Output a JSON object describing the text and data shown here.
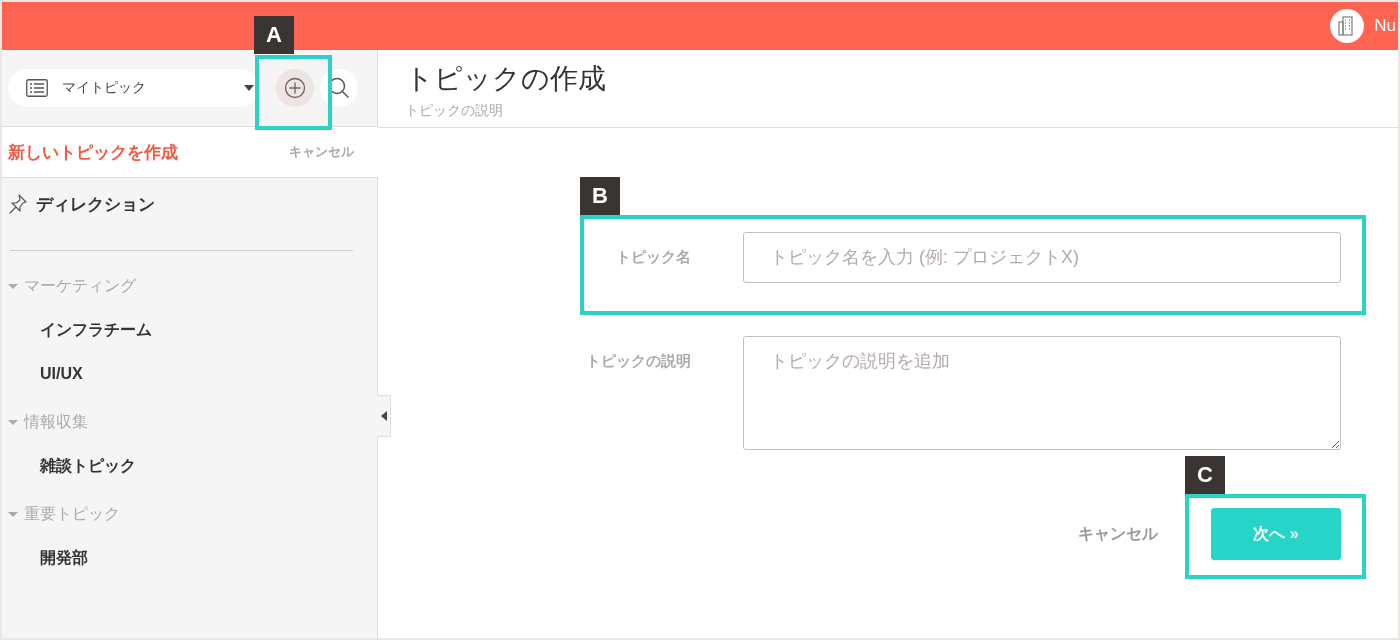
{
  "topbar": {
    "user_name": "Nu"
  },
  "sidebar": {
    "topic_select": {
      "value": "マイトピック"
    },
    "new_topic": {
      "title": "新しいトピックを作成",
      "cancel": "キャンセル"
    },
    "pinned": [
      {
        "label": "ディレクション"
      }
    ],
    "groups": [
      {
        "label": "マーケティング",
        "expanded": true,
        "children": [
          {
            "label": "インフラチーム"
          },
          {
            "label": "UI/UX"
          }
        ]
      },
      {
        "label": "情報収集",
        "expanded": true,
        "children": [
          {
            "label": "雑談トピック"
          }
        ]
      },
      {
        "label": "重要トピック",
        "expanded": true,
        "children": [
          {
            "label": "開発部"
          }
        ]
      }
    ]
  },
  "header": {
    "title": "トピックの作成",
    "subtitle": "トピックの説明"
  },
  "form": {
    "fields": [
      {
        "kind": "input",
        "label": "トピック名",
        "placeholder": "トピック名を入力 (例: プロジェクトX)"
      },
      {
        "kind": "textarea",
        "label": "トピックの説明",
        "placeholder": "トピックの説明を追加"
      }
    ],
    "cancel": "キャンセル",
    "next": "次へ »"
  },
  "callouts": [
    {
      "label": "A"
    },
    {
      "label": "B"
    },
    {
      "label": "C"
    }
  ]
}
